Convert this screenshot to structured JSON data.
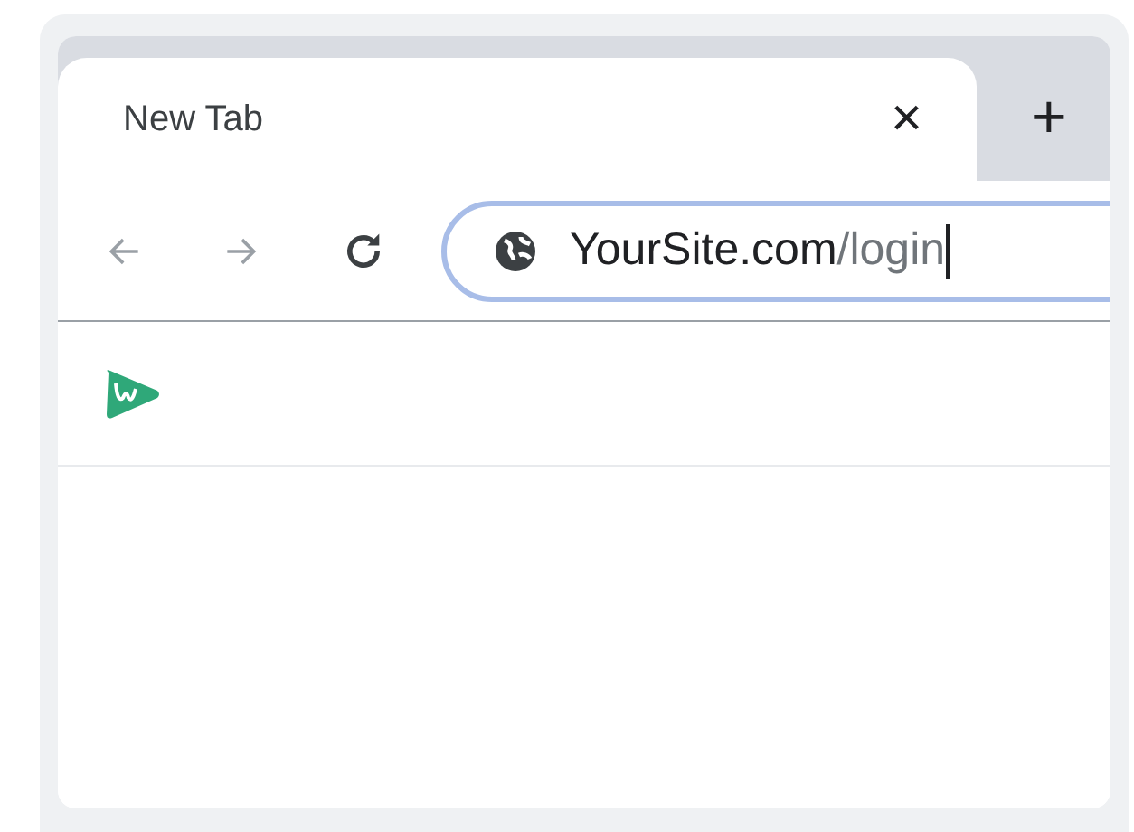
{
  "tab": {
    "title": "New Tab",
    "close": "×",
    "new_tab": "+"
  },
  "address_bar": {
    "host": "YourSite.com",
    "path": "/login",
    "focused": true
  }
}
